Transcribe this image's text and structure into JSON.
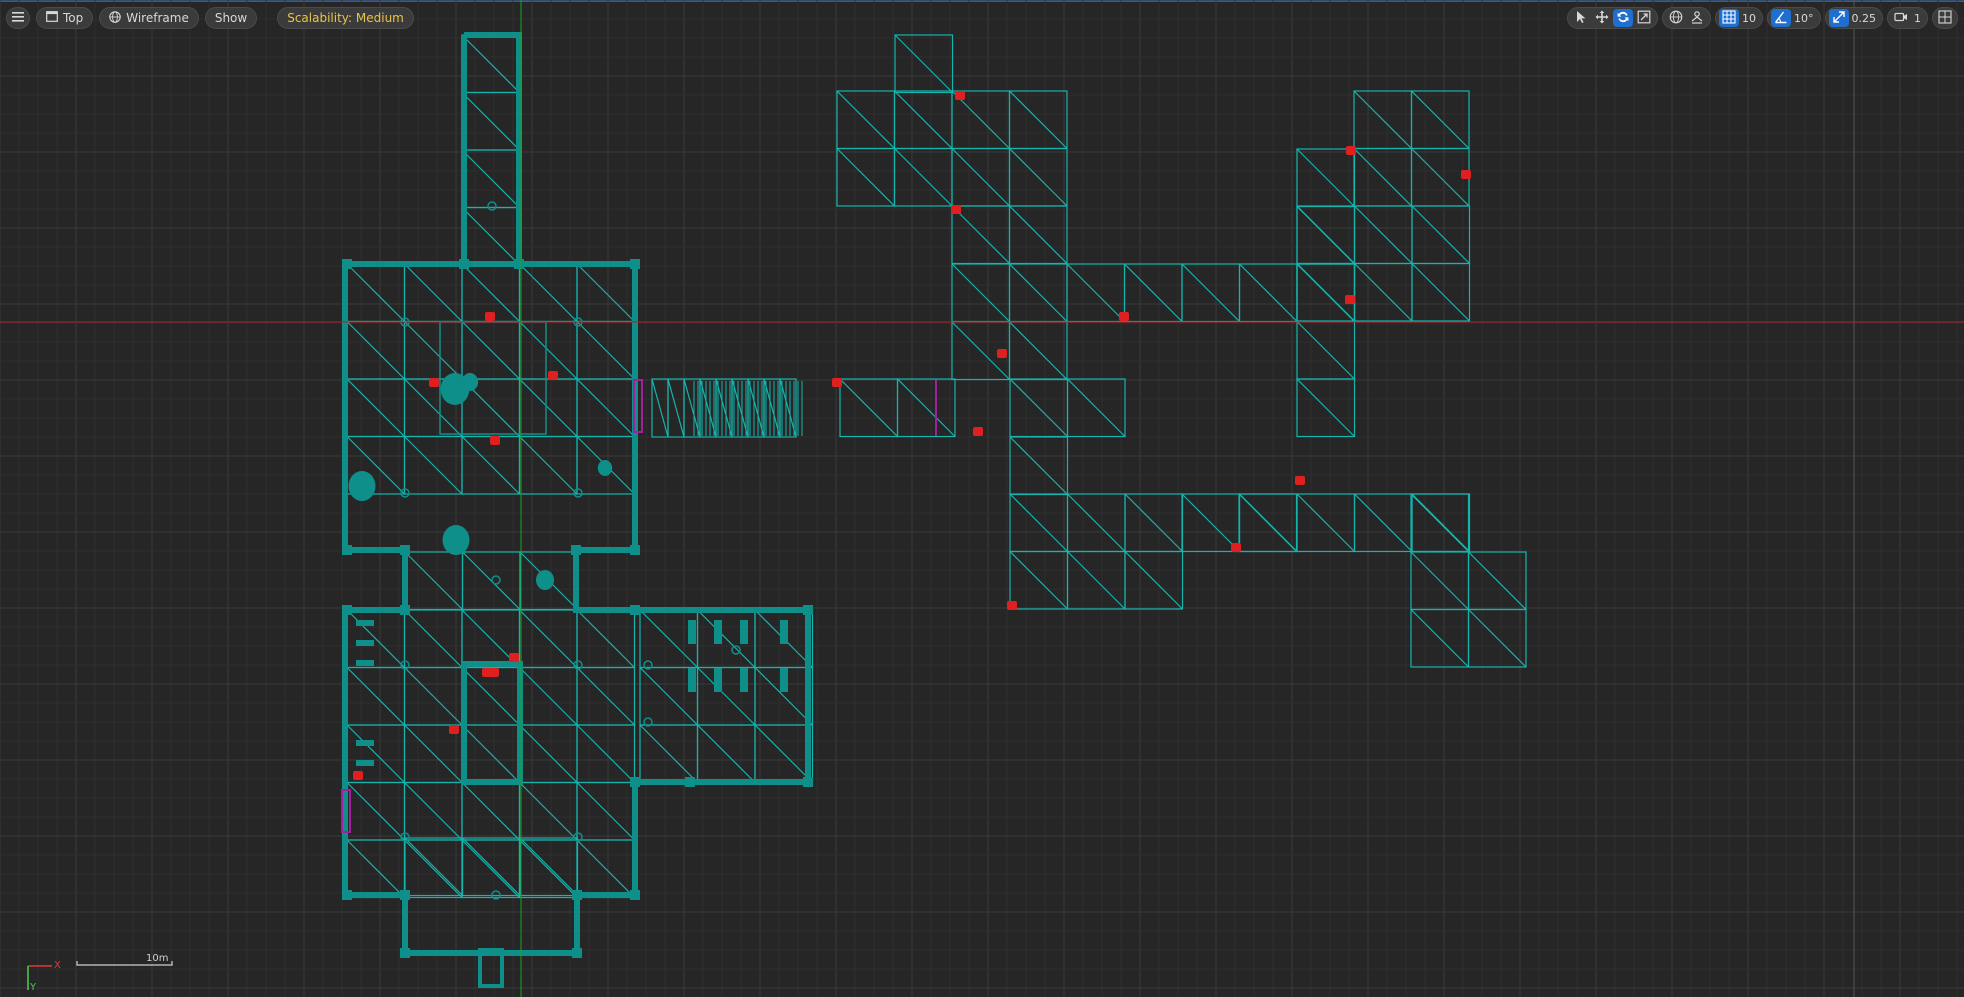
{
  "viewport": {
    "view_label": "Top",
    "render_mode_label": "Wireframe",
    "show_label": "Show",
    "scalability_label": "Scalability: Medium"
  },
  "toolbar_right": {
    "grid_snap_value": "10",
    "rotation_snap_value": "10°",
    "scale_snap_value": "0.25",
    "camera_speed_value": "1"
  },
  "scale_bar": {
    "label": "10m"
  },
  "axis_gizmo": {
    "x_label": "X",
    "y_label": "Y"
  },
  "colors": {
    "background": "#262626",
    "grid_minor": "#2e2e2e",
    "grid_major": "#3a3a3a",
    "wireframe": "#0f8f8a",
    "navmesh": "#14b5ad",
    "marker": "#e02020",
    "volume": "#a020a0",
    "accent": "#1f6fd1",
    "warning": "#e8c544"
  }
}
